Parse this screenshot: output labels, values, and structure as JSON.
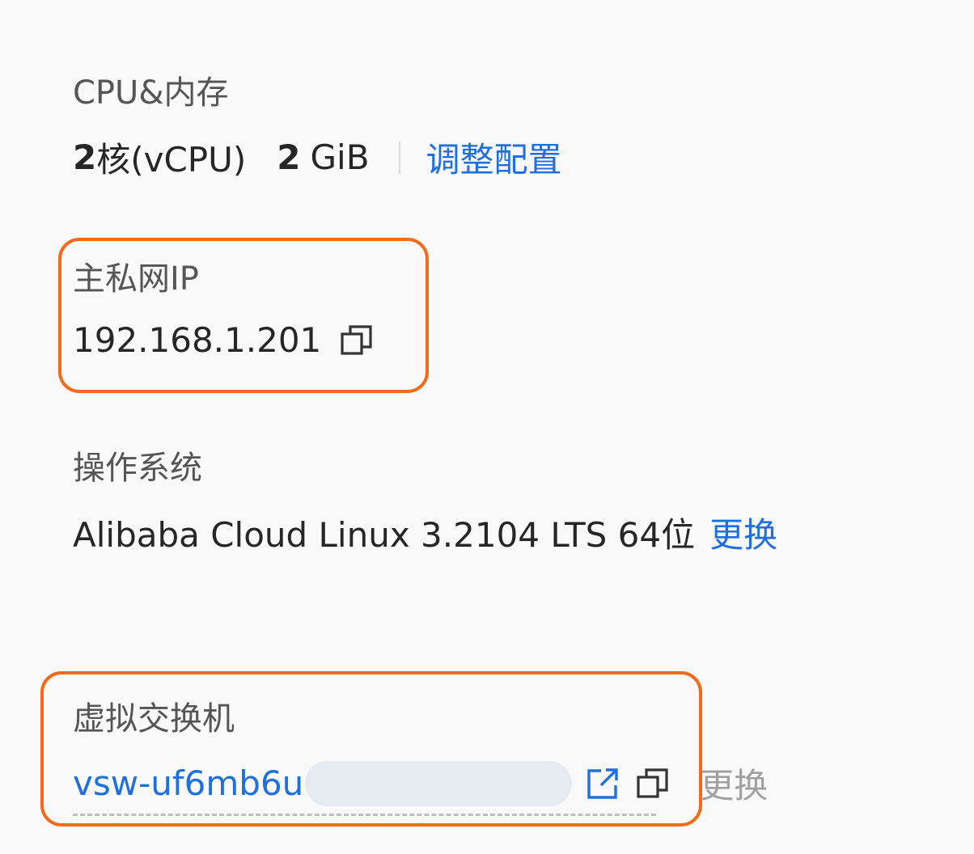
{
  "cpu_memory": {
    "label": "CPU&内存",
    "cores": "2",
    "cores_unit": "核(vCPU)",
    "memory": "2",
    "memory_unit": "GiB",
    "adjust_label": "调整配置"
  },
  "private_ip": {
    "label": "主私网IP",
    "value": "192.168.1.201"
  },
  "os": {
    "label": "操作系统",
    "value": "Alibaba Cloud Linux 3.2104 LTS 64位",
    "change_label": "更换"
  },
  "vswitch": {
    "label": "虚拟交换机",
    "id_visible": "vsw-uf6mb6u",
    "change_label": "更换"
  },
  "colors": {
    "highlight": "#f26b1a",
    "link": "#1f6fde",
    "disabled": "#a0a0a0"
  },
  "icons": {
    "copy": "copy-icon",
    "external": "external-link-icon"
  }
}
